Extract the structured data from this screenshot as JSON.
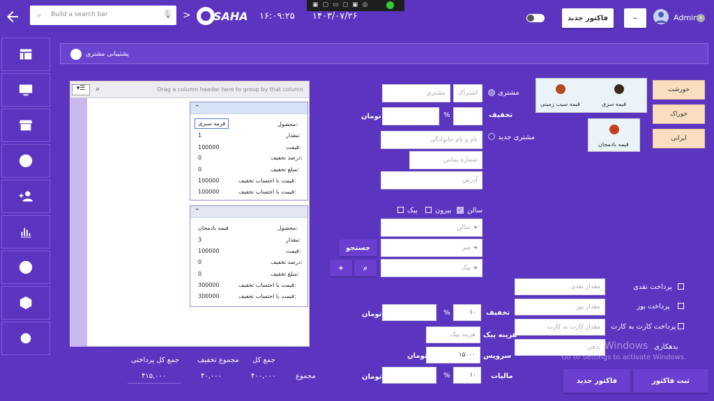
{
  "topbar": {
    "search_placeholder": "Build a search bar",
    "logo_text": "SAHA",
    "time": "۱۶:۰۹:۲۵",
    "date": "۱۴۰۳/۰۷/۲۶",
    "new_invoice": "فاکتور جدید",
    "minus": "-",
    "user": "Admin"
  },
  "panel": {
    "title": "پشتیبانی مشتری"
  },
  "categories": [
    "خورشت",
    "خوراک",
    "ایرانی"
  ],
  "products": [
    {
      "name": "قیمه سزی",
      "color": "#3a2a1a"
    },
    {
      "name": "قیمه سیب زمینی",
      "color": "#b5491f"
    },
    {
      "name": "قیمه بادمجان",
      "color": "#c2411b"
    }
  ],
  "grid": {
    "group_hint": "Drag a column header here to group by that column"
  },
  "labels": {
    "product": "محصول:",
    "qty": "مقدار:",
    "price": "قیمت:",
    "discount_pct": "درصد تخفیف:",
    "discount_amt": "مبلغ تخفیف:",
    "total_after": "قیمت با احتساب تخفیف:"
  },
  "items": [
    {
      "product": "قرمه سبزی",
      "qty": "1",
      "price": "100000",
      "pct": "0",
      "amt": "0",
      "t1": "100000",
      "t2": "100000"
    },
    {
      "product": "قیمه بادمجان",
      "qty": "3",
      "price": "100000",
      "pct": "0",
      "amt": "0",
      "t1": "300000",
      "t2": "300000"
    }
  ],
  "customer": {
    "radio_customer": "مشتری",
    "subscription": "اشتراک",
    "customer_ph": "مشتری",
    "discount_label": "تخفیف",
    "pct": "%",
    "toman": "تومان",
    "radio_new": "مشتری جدید",
    "name_ph": "نام و نام خانوادگی",
    "phone_ph": "شماره تماس",
    "address_ph": "آدرس"
  },
  "service": {
    "hall": "سالن",
    "out": "بیرون",
    "courier": "پیک",
    "hall_ph": "سالن",
    "table_ph": "میز",
    "courier_ph": "پیک",
    "search_btn": "جستجو",
    "plus": "+"
  },
  "payment": {
    "discount": "تخفیف",
    "pct": "%",
    "toman": "تومان",
    "discount_val": "۱۰",
    "courier_fee": "هزینه پیک",
    "courier_fee_ph": "هزینه پیک",
    "service": "سرویس",
    "service_val": "۱۵۰۰۰",
    "tax": "مالیات",
    "tax_val": "۱۰",
    "cash": "پرداخت نقدی",
    "cash_ph": "مقدار نقدی",
    "pos": "پرداخت پوز",
    "pos_ph": "مقدار پوز",
    "card": "پرداخت کارت به کارت",
    "card_ph": "مقدار کارت به کارت",
    "debt": "بدهکاری",
    "debt_ph": "بدهی",
    "new_btn": "فاکتور جدید",
    "save_btn": "ثبت فاکتور"
  },
  "totals": {
    "row_label": "مجموع",
    "total_label": "جمع کل",
    "total": "۴۰۰,۰۰۰",
    "disc_label": "مجموع تخفیف",
    "disc": "۴۰,۰۰۰",
    "pay_label": "جمع کل پرداختی",
    "pay": "۴۱۵,۰۰۰"
  },
  "watermark": {
    "title": "Activate Windows",
    "sub": "Go to Settings to activate Windows."
  }
}
